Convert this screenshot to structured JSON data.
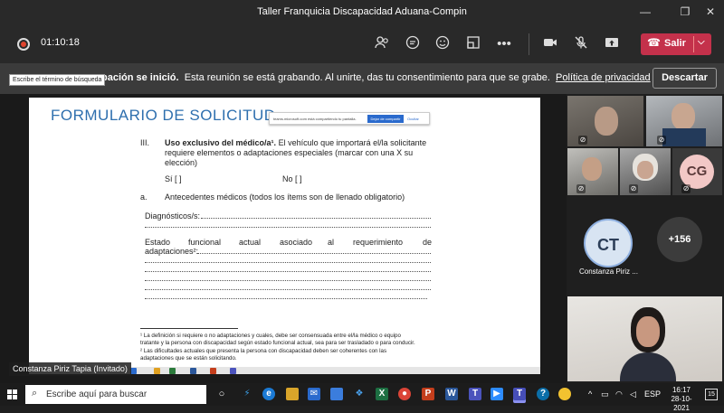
{
  "window": {
    "title": "Taller Franquicia Discapacidad Aduana-Compin"
  },
  "toolbar": {
    "timer": "01:10:18",
    "leave_label": "Salir",
    "icons": [
      "participants-icon",
      "chat-icon",
      "reactions-icon",
      "rooms-icon",
      "more-icon",
      "camera-icon",
      "mic-off-icon",
      "share-icon"
    ]
  },
  "banner": {
    "bold_text": "pación se inició.",
    "text": "Esta reunión se está grabando. Al unirte, das tu consentimiento para que se grabe.",
    "link": "Política de privacidad",
    "discard_label": "Descartar",
    "tooltip": "Escribe el término de búsqueda"
  },
  "document": {
    "title": "FORMULARIO DE SOLICITUD",
    "share_bar": {
      "text": "teams.microsoft.com está compartiendo tu pantalla.",
      "stop_label": "Dejar de compartir",
      "hide_label": "Ocultar"
    },
    "section_number": "III.",
    "section_bold": "Uso exclusivo del médico/a¹.",
    "section_text_1": "El vehículo que importará el/la solicitante",
    "section_text_2": "requiere elementos o adaptaciones especiales (marcar con una X su",
    "section_text_3": "elección)",
    "si_label": "Sí  [     ]",
    "no_label": "No  [     ]",
    "subsection_letter": "a.",
    "subsection_text": "Antecedentes médicos (todos los ítems son de llenado obligatorio)",
    "diagnosticos_label": "Diagnósticos/s:",
    "estado_words": [
      "Estado",
      "funcional",
      "actual",
      "asociado",
      "al",
      "requerimiento",
      "de"
    ],
    "adaptaciones_label": "adaptaciones²:",
    "footnote_1a": "¹ La definición si requiere o no adaptaciones y cuales, debe ser consensuada entre el/la médico o equipo",
    "footnote_1b": "tratante y la persona con discapacidad según estado funcional actual, sea para ser trasladado o para conducir.",
    "footnote_2a": "² Las dificultades actuales que presenta la persona con discapacidad deben ser coherentes con las",
    "footnote_2b": "adaptaciones que se están solicitando."
  },
  "presenter": {
    "name": "Constanza Piriz Tapia (Invitado)"
  },
  "participants": {
    "cg_initials": "CG",
    "ct_initials": "CT",
    "ct_name": "Constanza Piriz ...",
    "overflow_count": "+156"
  },
  "taskbar": {
    "search_placeholder": "Escribe aquí para buscar",
    "language": "ESP",
    "time": "16:17",
    "date": "28-10-2021",
    "notification_count": "15"
  }
}
